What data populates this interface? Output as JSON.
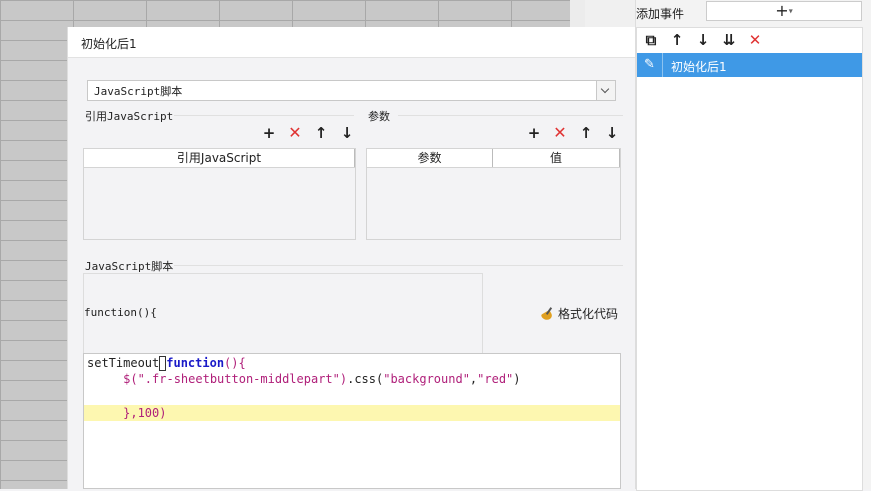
{
  "dialog": {
    "title": "初始化后1",
    "script_type": "JavaScript脚本",
    "ref_section_title": "引用JavaScript",
    "params_section_title": "参数",
    "ref_table": {
      "columns": [
        "引用JavaScript"
      ]
    },
    "params_table": {
      "columns": [
        "参数",
        "值"
      ]
    },
    "script_section_title": "JavaScript脚本",
    "function_header": "function(){",
    "format_button": "格式化代码",
    "code_lines": [
      "setTimeout(function(){",
      "     $(\".fr-sheetbutton-middlepart\").css(\"background\",\"red\")",
      "",
      "     },100)"
    ],
    "toolbar_icons": [
      "plus-icon",
      "delete-icon",
      "arrow-up-icon",
      "arrow-down-icon"
    ]
  },
  "events_panel": {
    "add_label": "添加事件",
    "add_button": "+",
    "toolbar_icons": [
      "copy-icon",
      "arrow-up-icon",
      "arrow-down-icon",
      "move-bottom-icon",
      "delete-icon"
    ],
    "items": [
      {
        "label": "初始化后1",
        "selected": true
      }
    ]
  },
  "colors": {
    "selected": "#3f99e6",
    "highlight_line": "#fdf7b0",
    "delete": "#e03333",
    "keyword": "#1a1ac8",
    "string": "#b0207a"
  }
}
